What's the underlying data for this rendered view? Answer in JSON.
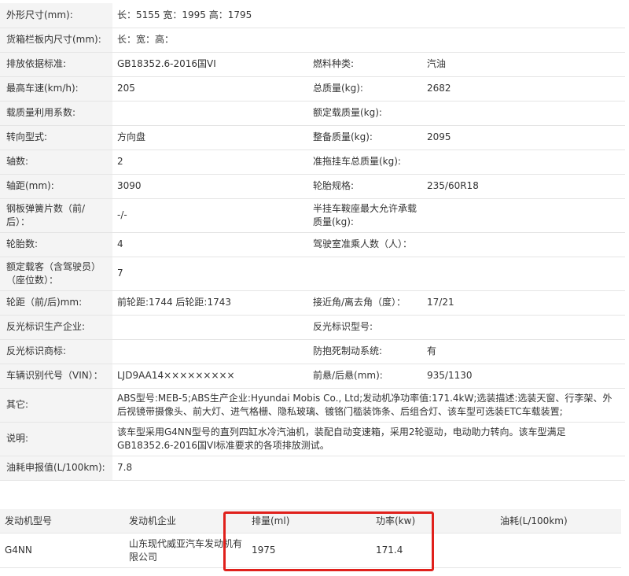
{
  "spec": {
    "rows": [
      {
        "label": "外形尺寸(mm):",
        "value": "长：5155 宽：1995 高：1795"
      },
      {
        "label": "货箱栏板内尺寸(mm):",
        "value": "长：宽：高："
      },
      {
        "label": "排放依据标准:",
        "value": "GB18352.6-2016国VI",
        "label2": "燃料种类:",
        "value2": "汽油"
      },
      {
        "label": "最高车速(km/h):",
        "value": "205",
        "label2": "总质量(kg):",
        "value2": "2682"
      },
      {
        "label": "载质量利用系数:",
        "value": "",
        "label2": "额定载质量(kg):",
        "value2": ""
      },
      {
        "label": "转向型式:",
        "value": "方向盘",
        "label2": "整备质量(kg):",
        "value2": "2095"
      },
      {
        "label": "轴数:",
        "value": "2",
        "label2": "准拖挂车总质量(kg):",
        "value2": ""
      },
      {
        "label": "轴距(mm):",
        "value": "3090",
        "label2": "轮胎规格:",
        "value2": "235/60R18"
      },
      {
        "label": "钢板弹簧片数（前/后）：",
        "value": "-/-",
        "label2": "半挂车鞍座最大允许承载质量(kg):",
        "value2": ""
      },
      {
        "label": "轮胎数:",
        "value": "4",
        "label2": "驾驶室准乘人数（人）：",
        "value2": ""
      },
      {
        "label": "额定载客（含驾驶员）（座位数）：",
        "value": "7"
      },
      {
        "label": "轮距（前/后)mm:",
        "value": "前轮距:1744 后轮距:1743",
        "label2": "接近角/离去角（度）：",
        "value2": "17/21"
      },
      {
        "label": "反光标识生产企业:",
        "value": "",
        "label2": "反光标识型号:",
        "value2": ""
      },
      {
        "label": "反光标识商标:",
        "value": "",
        "label2": "防抱死制动系统:",
        "value2": "有"
      },
      {
        "label": "车辆识别代号（VIN）：",
        "value": "LJD9AA14×××××××××",
        "label2": "前悬/后悬(mm):",
        "value2": "935/1130"
      },
      {
        "label": "其它:",
        "value": "ABS型号:MEB-5;ABS生产企业:Hyundai Mobis Co., Ltd;发动机净功率值:171.4kW;选装描述:选装天窗、行李架、外后视镜带摄像头、前大灯、进气格栅、隐私玻璃、镀铬门槛装饰条、后组合灯、该车型可选装ETC车载装置;"
      },
      {
        "label": "说明:",
        "value": "该车型采用G4NN型号的直列四缸水冷汽油机，装配自动变速箱，采用2轮驱动，电动助力转向。该车型满足GB18352.6-2016国VI标准要求的各项排放测试。"
      },
      {
        "label": "油耗申报值(L/100km):",
        "value": "7.8"
      }
    ]
  },
  "engine": {
    "headers": [
      "发动机型号",
      "发动机企业",
      "排量(ml)",
      "功率(kw)",
      "油耗(L/100km)"
    ],
    "row": [
      "G4NN",
      "山东现代威亚汽车发动机有限公司",
      "1975",
      "171.4",
      ""
    ]
  },
  "colors": {
    "label_bg": "#f4f4f4",
    "highlight": "#e0201b",
    "border": "#e5e5e5"
  }
}
